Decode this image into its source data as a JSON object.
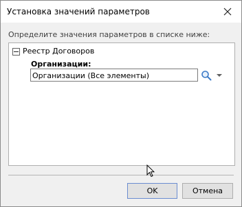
{
  "window": {
    "title": "Установка значений параметров"
  },
  "instruction": "Определите значения параметров в списке ниже:",
  "tree": {
    "node_label": "Реестр Договоров",
    "param_label": "Организации:",
    "param_value": "Организации (Все элементы)"
  },
  "buttons": {
    "ok": "OK",
    "cancel": "Отмена"
  },
  "icons": {
    "close": "close-icon",
    "collapse": "minus-box-icon",
    "search": "magnifier-icon",
    "dropdown": "chevron-down-icon",
    "cursor": "mouse-pointer-icon"
  },
  "colors": {
    "search_icon": "#3c7ac7",
    "ok_border": "#6a8cd0"
  }
}
